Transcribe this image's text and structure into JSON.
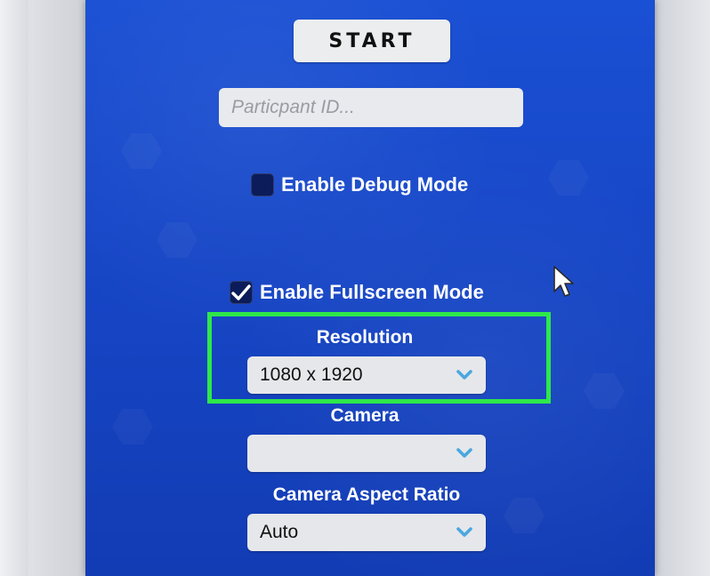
{
  "start_button": {
    "label": "START"
  },
  "participant_input": {
    "placeholder": "Particpant ID...",
    "value": ""
  },
  "debug_toggle": {
    "label": "Enable Debug Mode",
    "checked": false
  },
  "fullscreen_toggle": {
    "label": "Enable Fullscreen Mode",
    "checked": true
  },
  "resolution": {
    "label": "Resolution",
    "selected": "1080 x 1920"
  },
  "camera": {
    "label": "Camera",
    "selected": ""
  },
  "camera_aspect_ratio": {
    "label": "Camera Aspect Ratio",
    "selected": "Auto"
  },
  "colors": {
    "panel": "#1747c8",
    "highlight": "#2ee84a",
    "chevron": "#4aa7e0"
  },
  "icons": {
    "checkbox_checked": "check-icon",
    "dropdown_arrow": "chevron-down-icon",
    "pointer": "mouse-cursor-icon"
  }
}
